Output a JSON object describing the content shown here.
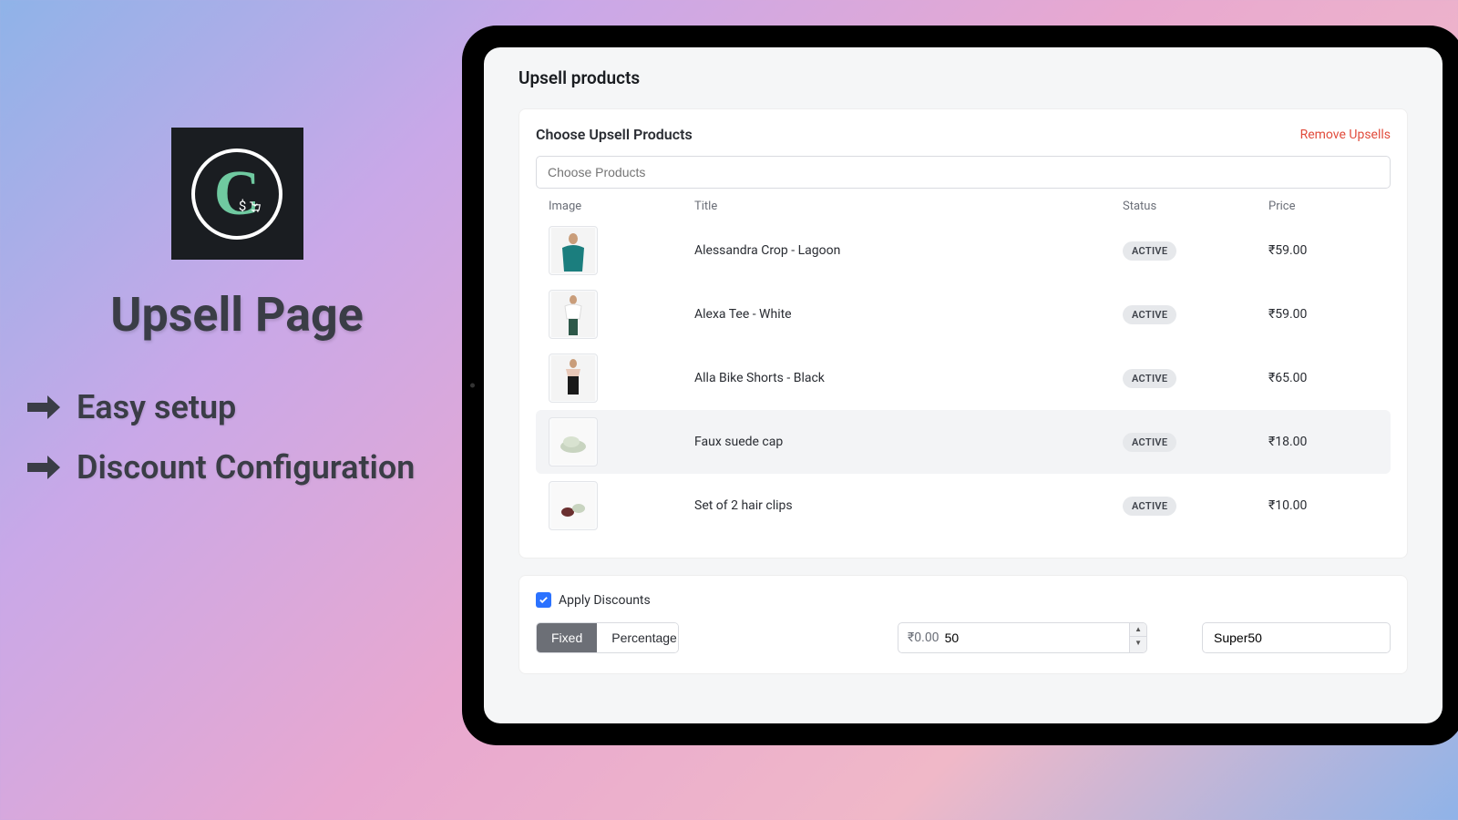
{
  "promo": {
    "title": "Upsell Page",
    "bullets": [
      "Easy setup",
      "Discount Configuration"
    ]
  },
  "page": {
    "heading": "Upsell products",
    "card_title": "Choose Upsell Products",
    "remove_label": "Remove Upsells",
    "choose_placeholder": "Choose Products",
    "columns": {
      "image": "Image",
      "title": "Title",
      "status": "Status",
      "price": "Price"
    },
    "products": [
      {
        "title": "Alessandra Crop - Lagoon",
        "status": "ACTIVE",
        "price": "₹59.00"
      },
      {
        "title": "Alexa Tee - White",
        "status": "ACTIVE",
        "price": "₹59.00"
      },
      {
        "title": "Alla Bike Shorts - Black",
        "status": "ACTIVE",
        "price": "₹65.00"
      },
      {
        "title": "Faux suede cap",
        "status": "ACTIVE",
        "price": "₹18.00"
      },
      {
        "title": "Set of 2 hair clips",
        "status": "ACTIVE",
        "price": "₹10.00"
      }
    ],
    "discount": {
      "apply_label": "Apply Discounts",
      "fixed_label": "Fixed",
      "percentage_label": "Percentage",
      "currency_prefix": "₹0.00",
      "amount_value": "50",
      "code_value": "Super50"
    }
  }
}
